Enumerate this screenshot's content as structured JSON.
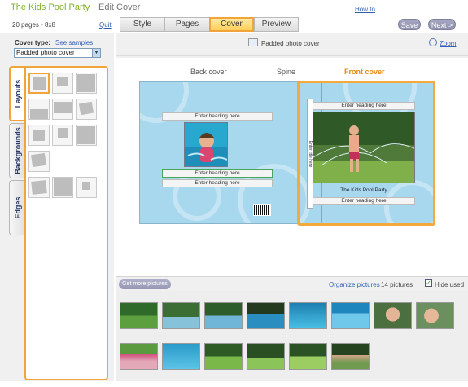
{
  "app": {
    "title": "The Kids Pool Party",
    "separator": "|",
    "subtitle": "Edit Cover",
    "how_to": "How to"
  },
  "nav": {
    "pages_info": "20 pages - 8x8",
    "quit": "Quit",
    "tabs": [
      {
        "label": "Style",
        "active": false
      },
      {
        "label": "Pages",
        "active": false
      },
      {
        "label": "Cover",
        "active": true
      },
      {
        "label": "Preview",
        "active": false
      }
    ],
    "save": "Save",
    "next": "Next >"
  },
  "left": {
    "cover_type_label": "Cover type:",
    "see_samples": "See samples",
    "cover_type_value": "Padded photo cover",
    "vtabs": [
      {
        "label": "Layouts",
        "active": true
      },
      {
        "label": "Backgrounds",
        "active": false
      },
      {
        "label": "Edges",
        "active": false
      }
    ]
  },
  "main": {
    "cover_type": "Padded photo cover",
    "zoom": "Zoom",
    "back_cover": "Back cover",
    "spine": "Spine",
    "front_cover": "Front cover",
    "heading_placeholder": "Enter heading here",
    "spine_text": "Enter title here",
    "front_caption": "The Kids Pool Party"
  },
  "tray": {
    "get_more": "Get more pictures",
    "organize": "Organize pictures",
    "count": "14 pictures",
    "hide_used": "Hide used",
    "hide_used_checked": true
  },
  "colors": {
    "accent": "#f0a43a",
    "brand_green": "#7fb22a",
    "link": "#2f5fb3",
    "cover_bg": "#a8d8ee"
  }
}
